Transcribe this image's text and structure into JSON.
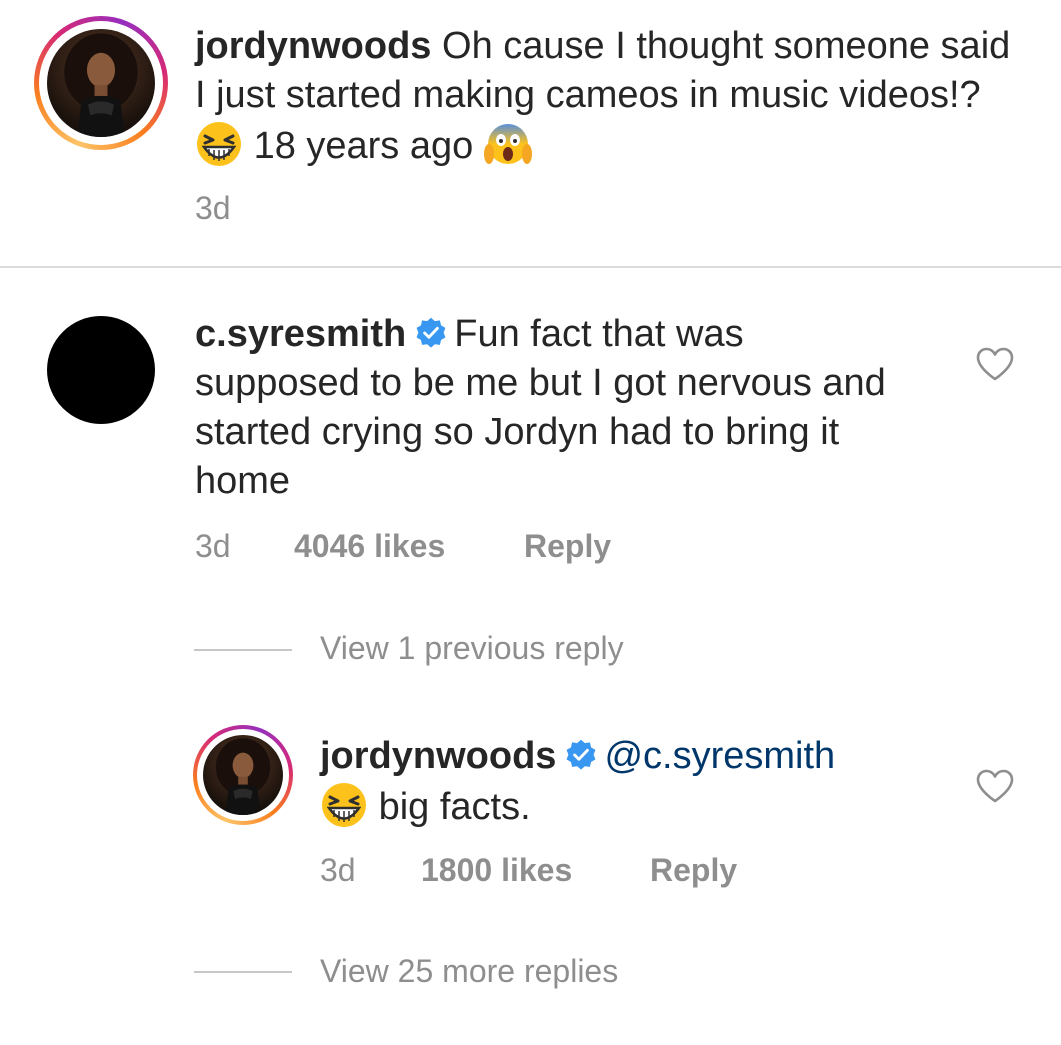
{
  "comments": [
    {
      "username": "jordynwoods",
      "verified": false,
      "text_part1": "Oh cause I thought someone said I just started making cameos in music videos!?",
      "emoji1": "grinning-squinting-face",
      "text_part2": "18 years ago",
      "emoji2": "face-screaming-in-fear",
      "time": "3d"
    },
    {
      "username": "c.syresmith",
      "verified": true,
      "text": "Fun fact that was supposed to be me but I got nervous and started crying so Jordyn had to bring it home",
      "time": "3d",
      "likes": "4046 likes",
      "reply_label": "Reply",
      "view_previous": "View 1 previous reply"
    },
    {
      "username": "jordynwoods",
      "verified": true,
      "mention": "@c.syresmith",
      "emoji": "grinning-squinting-face",
      "text": "big facts.",
      "time": "3d",
      "likes": "1800 likes",
      "reply_label": "Reply",
      "view_more": "View 25 more replies"
    }
  ],
  "icons": {
    "heart": "heart-outline-icon",
    "verified": "verified-badge-icon"
  },
  "colors": {
    "verified_blue": "#3897f0",
    "mention_blue": "#00376b",
    "meta_gray": "#8e8e8e"
  }
}
